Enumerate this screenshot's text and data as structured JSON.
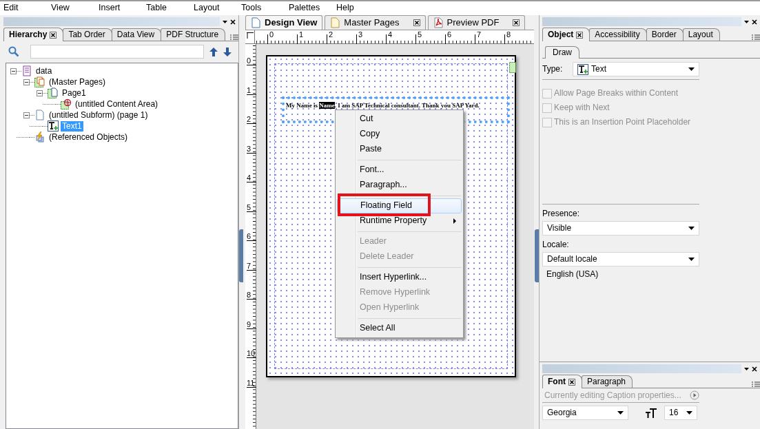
{
  "menu_bar": [
    "Edit",
    "View",
    "Insert",
    "Table",
    "Layout",
    "Tools",
    "Palettes",
    "Help"
  ],
  "left_panel": {
    "tabs": [
      {
        "label": "Hierarchy",
        "selected": true,
        "closable": true
      },
      {
        "label": "Tab Order",
        "selected": false,
        "closable": false
      },
      {
        "label": "Data View",
        "selected": false,
        "closable": false
      },
      {
        "label": "PDF Structure",
        "selected": false,
        "closable": false
      }
    ],
    "tree": [
      {
        "label": "data",
        "kind": "data",
        "expanded": true,
        "selected": false,
        "children": [
          {
            "label": "(Master Pages)",
            "kind": "master-pages",
            "expanded": true,
            "selected": false,
            "children": [
              {
                "label": "Page1",
                "kind": "page",
                "expanded": true,
                "selected": false,
                "children": [
                  {
                    "label": "(untitled Content Area)",
                    "kind": "content-area",
                    "selected": false
                  }
                ]
              }
            ]
          },
          {
            "label": "(untitled Subform) (page 1)",
            "kind": "subform",
            "expanded": true,
            "selected": false,
            "children": [
              {
                "label": "Text1",
                "kind": "text",
                "selected": true
              }
            ]
          },
          {
            "label": "(Referenced Objects)",
            "kind": "referenced",
            "selected": false
          }
        ]
      }
    ]
  },
  "center": {
    "tabs": [
      {
        "label": "Design View",
        "kind": "page",
        "selected": true,
        "closable": false
      },
      {
        "label": "Master Pages",
        "kind": "master",
        "selected": false,
        "closable": true
      },
      {
        "label": "Preview PDF",
        "kind": "pdf",
        "selected": false,
        "closable": true
      }
    ],
    "ruler": {
      "horizontal": [
        "0",
        "1",
        "2",
        "3",
        "4",
        "5",
        "6",
        "7",
        "8"
      ],
      "vertical": [
        "0",
        "1",
        "2",
        "3",
        "4",
        "5",
        "6",
        "7",
        "8",
        "9",
        "10",
        "11"
      ]
    },
    "document": {
      "text_before": "My Name is ",
      "selected_text": "Name",
      "text_after": ". I am SAP Technical consultant. Thank you SAP Yard."
    },
    "context_menu": [
      {
        "kind": "item",
        "label": "Cut",
        "disabled": false,
        "highlighted": false,
        "submenu": false,
        "marked": false
      },
      {
        "kind": "item",
        "label": "Copy",
        "disabled": false,
        "highlighted": false,
        "submenu": false,
        "marked": false
      },
      {
        "kind": "item",
        "label": "Paste",
        "disabled": false,
        "highlighted": false,
        "submenu": false,
        "marked": false
      },
      {
        "kind": "separator"
      },
      {
        "kind": "item",
        "label": "Font...",
        "disabled": false,
        "highlighted": false,
        "submenu": false,
        "marked": false
      },
      {
        "kind": "item",
        "label": "Paragraph...",
        "disabled": false,
        "highlighted": false,
        "submenu": false,
        "marked": false
      },
      {
        "kind": "separator"
      },
      {
        "kind": "item",
        "label": "Floating Field",
        "disabled": false,
        "highlighted": true,
        "submenu": false,
        "marked": true
      },
      {
        "kind": "item",
        "label": "Runtime Property",
        "disabled": false,
        "highlighted": false,
        "submenu": true,
        "marked": false
      },
      {
        "kind": "separator"
      },
      {
        "kind": "item",
        "label": "Leader",
        "disabled": true,
        "highlighted": false,
        "submenu": false,
        "marked": false
      },
      {
        "kind": "item",
        "label": "Delete Leader",
        "disabled": true,
        "highlighted": false,
        "submenu": false,
        "marked": false
      },
      {
        "kind": "separator"
      },
      {
        "kind": "item",
        "label": "Insert Hyperlink...",
        "disabled": false,
        "highlighted": false,
        "submenu": false,
        "marked": false
      },
      {
        "kind": "item",
        "label": "Remove Hyperlink",
        "disabled": true,
        "highlighted": false,
        "submenu": false,
        "marked": false
      },
      {
        "kind": "item",
        "label": "Open Hyperlink",
        "disabled": true,
        "highlighted": false,
        "submenu": false,
        "marked": false
      },
      {
        "kind": "separator"
      },
      {
        "kind": "item",
        "label": "Select All",
        "disabled": false,
        "highlighted": false,
        "submenu": false,
        "marked": false
      }
    ]
  },
  "right_panel": {
    "tabs": [
      {
        "label": "Object",
        "selected": true,
        "closable": true
      },
      {
        "label": "Accessibility",
        "selected": false,
        "closable": false
      },
      {
        "label": "Border",
        "selected": false,
        "closable": false
      },
      {
        "label": "Layout",
        "selected": false,
        "closable": false
      }
    ],
    "subtabs": [
      {
        "label": "Draw",
        "selected": true
      }
    ],
    "type": {
      "label": "Type:",
      "value": "Text"
    },
    "options": [
      {
        "label": "Allow Page Breaks within Content",
        "checked": false,
        "disabled": true
      },
      {
        "label": "Keep with Next",
        "checked": false,
        "disabled": true
      },
      {
        "label": "This is an Insertion Point Placeholder",
        "checked": false,
        "disabled": true
      }
    ],
    "presence": {
      "label": "Presence:",
      "value": "Visible"
    },
    "locale": {
      "label": "Locale:",
      "value": "Default locale",
      "detail": "English (USA)"
    }
  },
  "font_panel": {
    "tabs": [
      {
        "label": "Font",
        "selected": true,
        "closable": true
      },
      {
        "label": "Paragraph",
        "selected": false,
        "closable": false
      }
    ],
    "hint": "Currently editing Caption properties...",
    "font": "Georgia",
    "size": "16"
  }
}
